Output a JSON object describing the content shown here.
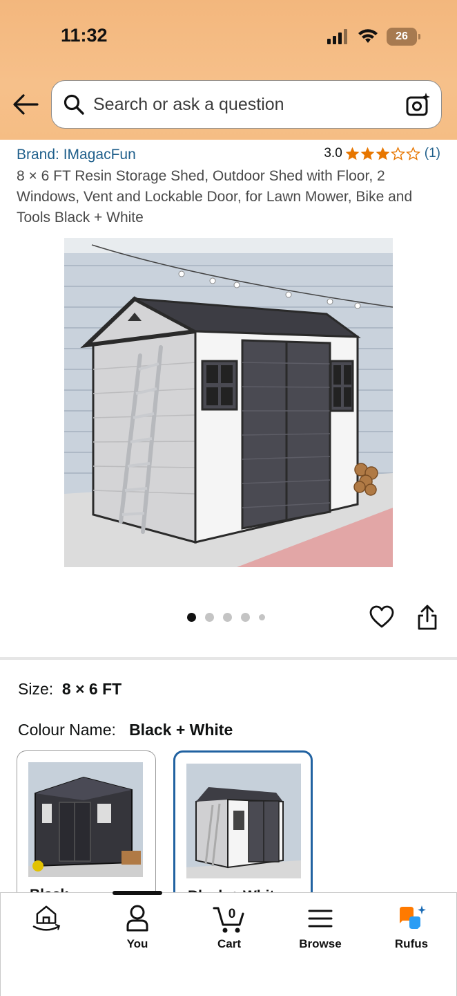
{
  "status_bar": {
    "time": "11:32",
    "battery": "26"
  },
  "search": {
    "placeholder": "Search or ask a question"
  },
  "product": {
    "brand": "Brand: IMagacFun",
    "rating_value": "3.0",
    "rating_stars": 3,
    "rating_count": "(1)",
    "title": "8 × 6 FT Resin Storage Shed, Outdoor Shed with Floor, 2 Windows, Vent and Lockable Door, for Lawn Mower, Bike and Tools Black + White",
    "image_count": 5,
    "active_image_index": 0
  },
  "options": {
    "size_label": "Size:",
    "size_value": "8 × 6 FT",
    "colour_label": "Colour Name:",
    "colour_value": "Black + White",
    "swatches": [
      {
        "label": "Black",
        "selected": false
      },
      {
        "label": "Black + White",
        "selected": true
      }
    ]
  },
  "bottom_nav": {
    "items": [
      {
        "label": "",
        "icon": "home-icon"
      },
      {
        "label": "You",
        "icon": "person-icon"
      },
      {
        "label": "Cart",
        "icon": "cart-icon",
        "badge": "0"
      },
      {
        "label": "Browse",
        "icon": "menu-icon"
      },
      {
        "label": "Rufus",
        "icon": "rufus-icon"
      }
    ]
  },
  "colors": {
    "header": "#f5bd84",
    "link": "#1f5f8b",
    "star": "#e77600",
    "selected_border": "#2162a1"
  }
}
